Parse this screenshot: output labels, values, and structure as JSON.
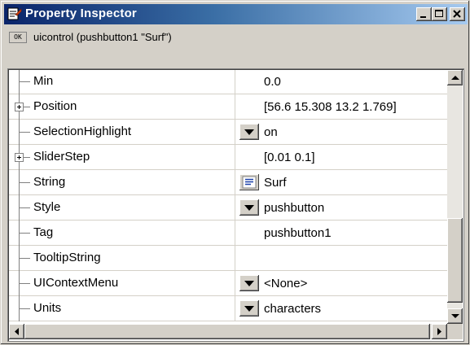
{
  "window": {
    "title": "Property Inspector",
    "buttons": [
      "minimize",
      "maximize",
      "close"
    ]
  },
  "object": {
    "icon_label": "OK",
    "description": "uicontrol (pushbutton1 \"Surf\")"
  },
  "properties": [
    {
      "name": "Min",
      "value": "0.0",
      "expandable": false,
      "editor": "none"
    },
    {
      "name": "Position",
      "value": "[56.6 15.308 13.2 1.769]",
      "expandable": true,
      "editor": "none"
    },
    {
      "name": "SelectionHighlight",
      "value": "on",
      "expandable": false,
      "editor": "dropdown"
    },
    {
      "name": "SliderStep",
      "value": "[0.01 0.1]",
      "expandable": true,
      "editor": "none"
    },
    {
      "name": "String",
      "value": "Surf",
      "expandable": false,
      "editor": "text-editor"
    },
    {
      "name": "Style",
      "value": "pushbutton",
      "expandable": false,
      "editor": "dropdown"
    },
    {
      "name": "Tag",
      "value": "pushbutton1",
      "expandable": false,
      "editor": "none"
    },
    {
      "name": "TooltipString",
      "value": "",
      "expandable": false,
      "editor": "none"
    },
    {
      "name": "UIContextMenu",
      "value": "<None>",
      "expandable": false,
      "editor": "dropdown"
    },
    {
      "name": "Units",
      "value": "characters",
      "expandable": false,
      "editor": "dropdown"
    }
  ],
  "colors": {
    "title_gradient_start": "#0a246a",
    "title_gradient_end": "#a6caf0",
    "face": "#d4d0c8"
  }
}
